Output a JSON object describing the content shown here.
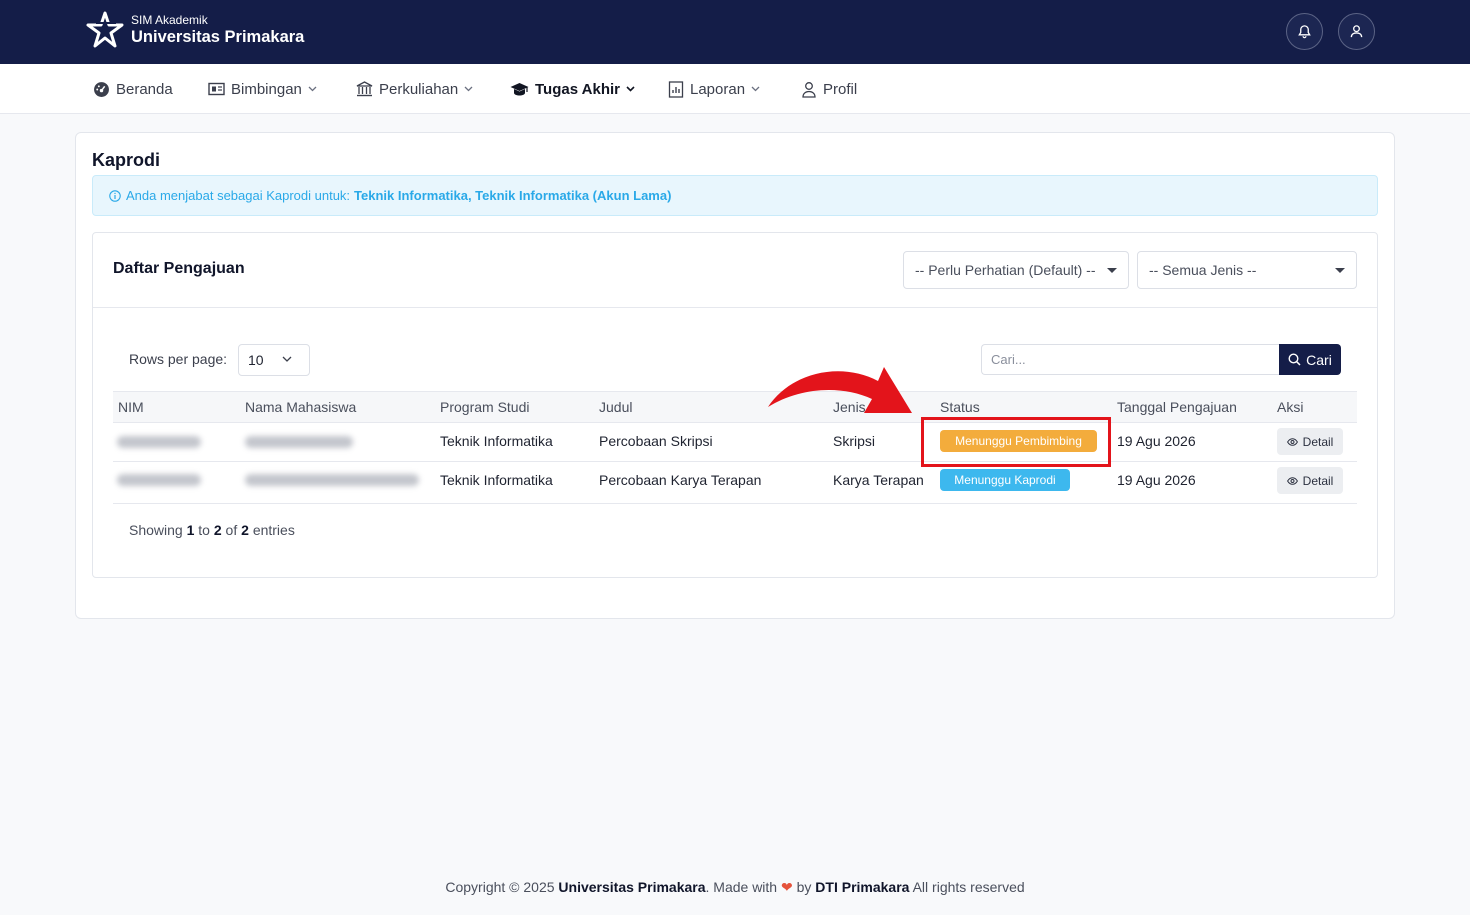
{
  "brand": {
    "subtitle": "SIM Akademik",
    "title": "Universitas Primakara"
  },
  "topbar_icons": [
    "bell-icon",
    "user-icon"
  ],
  "nav": {
    "items": [
      {
        "label": "Beranda",
        "icon": "dashboard-icon",
        "has_caret": false
      },
      {
        "label": "Bimbingan",
        "icon": "board-icon",
        "has_caret": true
      },
      {
        "label": "Perkuliahan",
        "icon": "building-icon",
        "has_caret": true
      },
      {
        "label": "Tugas Akhir",
        "icon": "graduation-cap-icon",
        "has_caret": true,
        "active": true
      },
      {
        "label": "Laporan",
        "icon": "report-icon",
        "has_caret": true
      },
      {
        "label": "Profil",
        "icon": "user-icon",
        "has_caret": false
      }
    ]
  },
  "page": {
    "title": "Kaprodi",
    "alert_prefix": "Anda menjabat sebagai Kaprodi untuk:",
    "alert_programs": "Teknik Informatika, Teknik Informatika (Akun Lama)"
  },
  "panel": {
    "title": "Daftar Pengajuan",
    "filter_status": "-- Perlu Perhatian (Default) --",
    "filter_jenis": "-- Semua Jenis --",
    "rows_per_page_label": "Rows per page:",
    "rows_per_page_value": "10",
    "search_placeholder": "Cari...",
    "search_button": "Cari"
  },
  "table": {
    "headers": [
      "NIM",
      "Nama Mahasiswa",
      "Program Studi",
      "Judul",
      "Jenis",
      "Status",
      "Tanggal Pengajuan",
      "Aksi"
    ],
    "rows": [
      {
        "program": "Teknik Informatika",
        "judul": "Percobaan Skripsi",
        "jenis": "Skripsi",
        "status": "Menunggu Pembimbing",
        "status_color": "#f3ac3c",
        "tanggal": "19 Agu 2026",
        "aksi": "Detail"
      },
      {
        "program": "Teknik Informatika",
        "judul": "Percobaan Karya Terapan",
        "jenis": "Karya Terapan",
        "status": "Menunggu Kaprodi",
        "status_color": "#3db8ee",
        "tanggal": "19 Agu 2026",
        "aksi": "Detail"
      }
    ]
  },
  "pagination": {
    "prefix": "Showing",
    "from": "1",
    "to_word": "to",
    "to": "2",
    "of_word": "of",
    "total": "2",
    "suffix": "entries"
  },
  "footer": {
    "copyright": "Copyright © 2025",
    "org": "Universitas Primakara",
    "made_with": ". Made with",
    "by": "by",
    "team": "DTI Primakara",
    "rights": "All rights reserved"
  },
  "colors": {
    "navy": "#141d48",
    "accent_blue": "#2aa9e8",
    "highlight_red": "#e3141b"
  }
}
